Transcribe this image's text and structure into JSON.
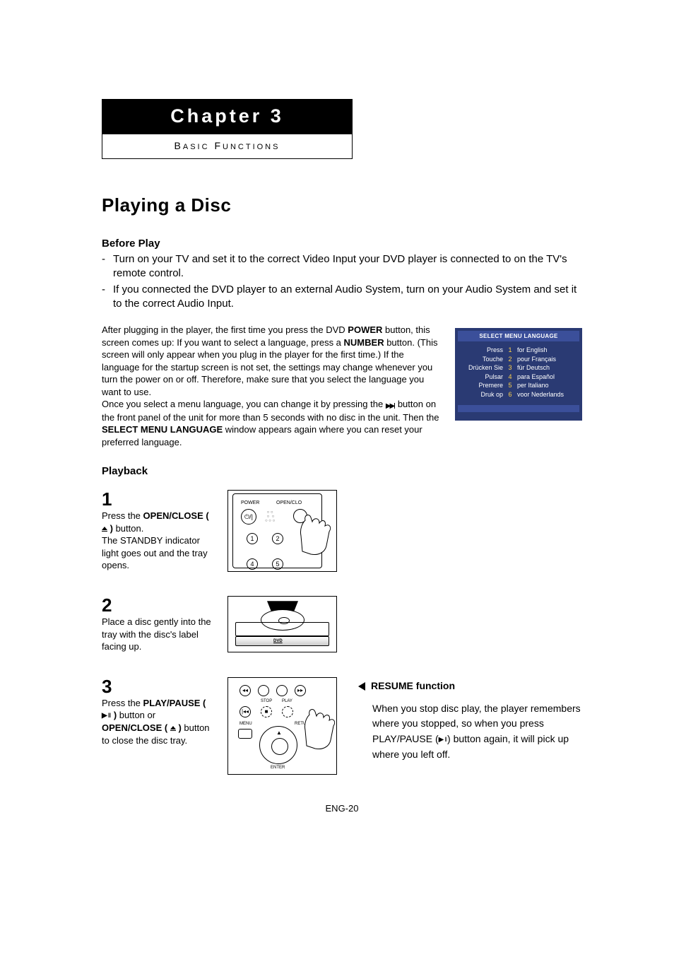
{
  "chapter": {
    "title": "Chapter 3",
    "subtitle": "Basic Functions"
  },
  "heading": "Playing a Disc",
  "before": {
    "head": "Before Play",
    "b1": "Turn on your TV and set it to the correct Video Input your DVD player is connected to on the TV's remote control.",
    "b2": "If you connected the DVD player to an external Audio System, turn on your Audio System and set it to the correct Audio Input."
  },
  "note": {
    "p1a": "After plugging in the player, the first time you press the DVD ",
    "p1b": "POWER",
    "p1c": " button, this screen comes up: If you want to select a language, press a ",
    "p1d": "NUMBER",
    "p1e": " button. (This screen will only appear when you plug in the player for the first time.) If the language for the startup screen is not set, the settings may change whenever you turn the power on or off. Therefore, make sure that you select the language you want to use.",
    "p2a": "Once you select a menu language, you can change it by pressing the ",
    "p2b": " button on the front panel of the unit for more than 5 seconds with no disc in the unit. Then the ",
    "p2c": "SELECT MENU LANGUAGE",
    "p2d": " window appears again where you can reset your preferred language."
  },
  "langbox": {
    "title": "SELECT MENU LANGUAGE",
    "rows": [
      {
        "l": "Press",
        "n": "1",
        "r": "for English"
      },
      {
        "l": "Touche",
        "n": "2",
        "r": "pour Français"
      },
      {
        "l": "Drücken Sie",
        "n": "3",
        "r": "für Deutsch"
      },
      {
        "l": "Pulsar",
        "n": "4",
        "r": "para Español"
      },
      {
        "l": "Premere",
        "n": "5",
        "r": "per Italiano"
      },
      {
        "l": "Druk op",
        "n": "6",
        "r": "voor Nederlands"
      }
    ]
  },
  "playback_head": "Playback",
  "steps": {
    "s1": {
      "n": "1",
      "a": "Press the ",
      "b": "OPEN/CLOSE (",
      "c": ")",
      "d": " button.",
      "e": "The STANDBY indicator light goes out and the tray opens."
    },
    "s2": {
      "n": "2",
      "t": "Place a disc gently into the tray with the disc's label facing up."
    },
    "s3": {
      "n": "3",
      "a": "Press the ",
      "b": "PLAY/PAUSE (",
      "c": ")",
      "d": " button or ",
      "e": "OPEN/CLOSE (",
      "f": ")",
      "g": " button to close the disc tray."
    }
  },
  "illus": {
    "i1": {
      "power": "POWER",
      "oc": "OPEN/CLO",
      "pwr_glyph": "⏻/|",
      "n1": "1",
      "n2": "2",
      "n4": "4",
      "n5": "5",
      "dots": "○ ○\n○  ○\n○ ○ ○"
    },
    "i2": {
      "label": "DVD"
    },
    "i3": {
      "stop": "STOP",
      "play": "PLAY",
      "menu": "MENU",
      "ret": "RETURN",
      "enter": "ENTER",
      "g1": "◂◂",
      "g4": "▸▸",
      "g5": "|◂◂",
      "g6": "■"
    }
  },
  "resume": {
    "head": "RESUME function",
    "t1": "When you stop disc play, the player remembers where you stopped, so when you press PLAY/PAUSE (",
    "t2": ") button again, it will pick up where you left off."
  },
  "footer": "ENG-20"
}
